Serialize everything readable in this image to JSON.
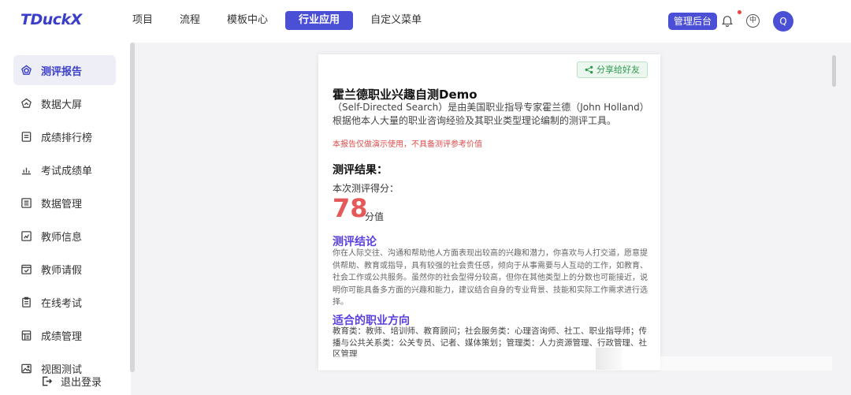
{
  "brand": "TDuckX",
  "nav": [
    "项目",
    "流程",
    "模板中心",
    "行业应用",
    "自定义菜单"
  ],
  "nav_active": "行业应用",
  "header": {
    "admin_label": "管理后台",
    "lang_label": "中",
    "avatar_letter": "Q"
  },
  "sidebar": {
    "items": [
      {
        "label": "测评报告",
        "icon": "pentagon-icon",
        "active": true
      },
      {
        "label": "数据大屏",
        "icon": "dashboard-icon"
      },
      {
        "label": "成绩排行榜",
        "icon": "list-icon"
      },
      {
        "label": "考试成绩单",
        "icon": "bar-chart-icon"
      },
      {
        "label": "数据管理",
        "icon": "table-icon"
      },
      {
        "label": "教师信息",
        "icon": "chart-box-icon"
      },
      {
        "label": "教师请假",
        "icon": "checkbox-icon"
      },
      {
        "label": "在线考试",
        "icon": "clipboard-icon"
      },
      {
        "label": "成绩管理",
        "icon": "grade-icon"
      },
      {
        "label": "视图测试",
        "icon": "image-icon"
      }
    ],
    "logout": "退出登录"
  },
  "report": {
    "share_label": "分享给好友",
    "title": "霍兰德职业兴趣自测Demo",
    "desc": "（Self-Directed Search）是由美国职业指导专家霍兰德（John Holland）根据他本人大量的职业咨询经验及其职业类型理论编制的测评工具。",
    "warning": "本报告仅做演示使用，不具备测评参考价值",
    "result_heading": "测评结果：",
    "score_label": "本次测评得分：",
    "score": "78",
    "score_unit": "分值",
    "conclusion_heading": "测评结论",
    "conclusion": "你在人际交往、沟通和帮助他人方面表现出较高的兴趣和潜力，你喜欢与人打交道，愿意提供帮助、教育或指导，具有较强的社会责任感，倾向于从事需要与人互动的工作，如教育、社会工作或公共服务。虽然你的社会型得分较高，但你在其他类型上的分数也可能接近，说明你可能具备多方面的兴趣和能力，建议结合自身的专业背景、技能和实际工作需求进行选择。",
    "career_heading": "适合的职业方向",
    "career": "教育类：教师、培训师、教育顾问；社会服务类：心理咨询师、社工、职业指导师；传播与公共关系类：公关专员、记者、媒体策划；管理类：人力资源管理、行政管理、社区管理"
  },
  "colors": {
    "accent": "#4a4fd6",
    "score": "#e45a5a",
    "section": "#5b3fe0",
    "warning": "#e04b4b",
    "share": "#2e9a4f"
  }
}
